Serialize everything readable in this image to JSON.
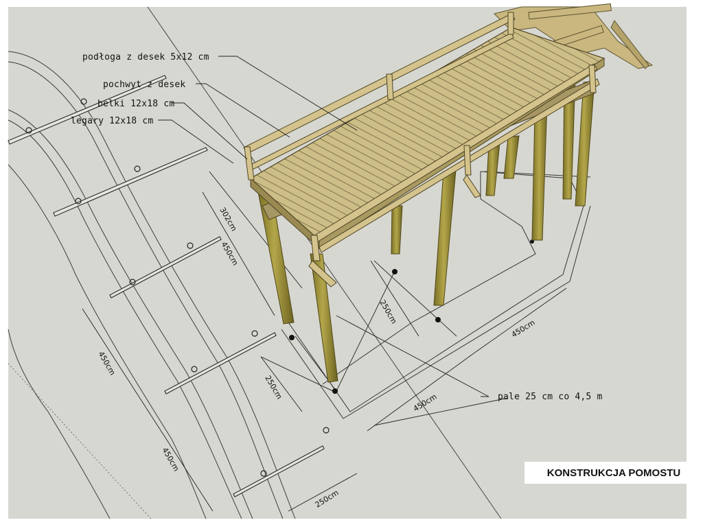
{
  "title": "KONSTRUKCJA POMOSTU",
  "labels": {
    "podloga": "podłoga z desek 5x12 cm",
    "pochwyt": "pochwyt z desek",
    "belki": "belki 12x18 cm",
    "legary": "legary 12x18 cm",
    "pale": "pale 25 cm co 4,5 m"
  },
  "dimensions": {
    "d302": "302cm",
    "d450_a": "450cm",
    "d250_a": "250cm",
    "d450_b": "450cm",
    "d450_c": "450cm",
    "d450_d": "450cm",
    "d250_b": "250cm",
    "d450_e": "450cm",
    "d250_c": "250cm"
  },
  "colors": {
    "background": "#d7d7d1",
    "wood": "#cbb980",
    "wood_dark": "#9a8a52",
    "pile": "#9c8f34",
    "pile_dark": "#6f6522"
  }
}
